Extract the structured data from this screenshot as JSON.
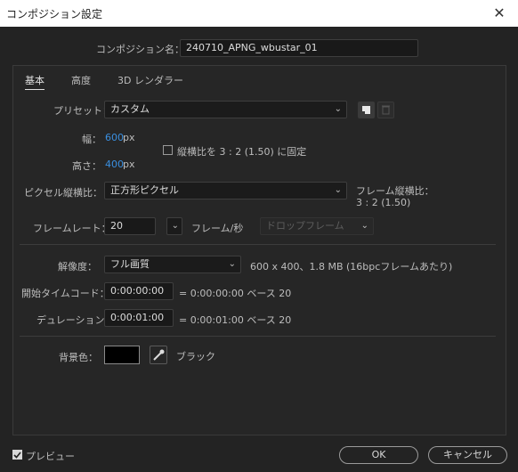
{
  "window": {
    "title": "コンポジション設定",
    "close_glyph": "✕"
  },
  "comp_name": {
    "label": "コンポジション名：",
    "value": "240710_APNG_wbustar_01"
  },
  "tabs": [
    {
      "label": "基本",
      "active": true
    },
    {
      "label": "高度",
      "active": false
    },
    {
      "label": "3D レンダラー",
      "active": false
    }
  ],
  "preset": {
    "label": "プリセット：",
    "value": "カスタム"
  },
  "width": {
    "label": "幅：",
    "value": "600",
    "unit": "px"
  },
  "height": {
    "label": "高さ：",
    "value": "400",
    "unit": "px"
  },
  "lock_aspect": {
    "label": "縦横比を 3 : 2 (1.50) に固定",
    "checked": false
  },
  "pixel_aspect": {
    "label": "ピクセル縦横比：",
    "value": "正方形ピクセル"
  },
  "frame_aspect": {
    "label": "フレーム縦横比：",
    "value": "3 : 2 (1.50)"
  },
  "frame_rate": {
    "label": "フレームレート：",
    "value": "20",
    "unit": "フレーム/秒",
    "drop_frame": "ドロップフレーム"
  },
  "resolution": {
    "label": "解像度：",
    "value": "フル画質",
    "info": "600 x 400、1.8 MB (16bpcフレームあたり)"
  },
  "start_timecode": {
    "label": "開始タイムコード：",
    "value": "0:00:00:00",
    "info": "= 0:00:00:00  ベース 20"
  },
  "duration": {
    "label": "デュレーション：",
    "value": "0:00:01:00",
    "info": "= 0:00:01:00  ベース 20"
  },
  "background": {
    "label": "背景色：",
    "color": "#000000",
    "name": "ブラック"
  },
  "preview": {
    "label": "プレビュー",
    "checked": true
  },
  "buttons": {
    "ok": "OK",
    "cancel": "キャンセル"
  },
  "icons": {
    "chevron": "chevron-down-icon",
    "eyedropper": "eyedropper-icon",
    "save_preset": "save-preset-icon",
    "delete_preset": "trash-icon"
  },
  "colors": {
    "accent_blue": "#3a8fe0",
    "background": "#232323"
  }
}
